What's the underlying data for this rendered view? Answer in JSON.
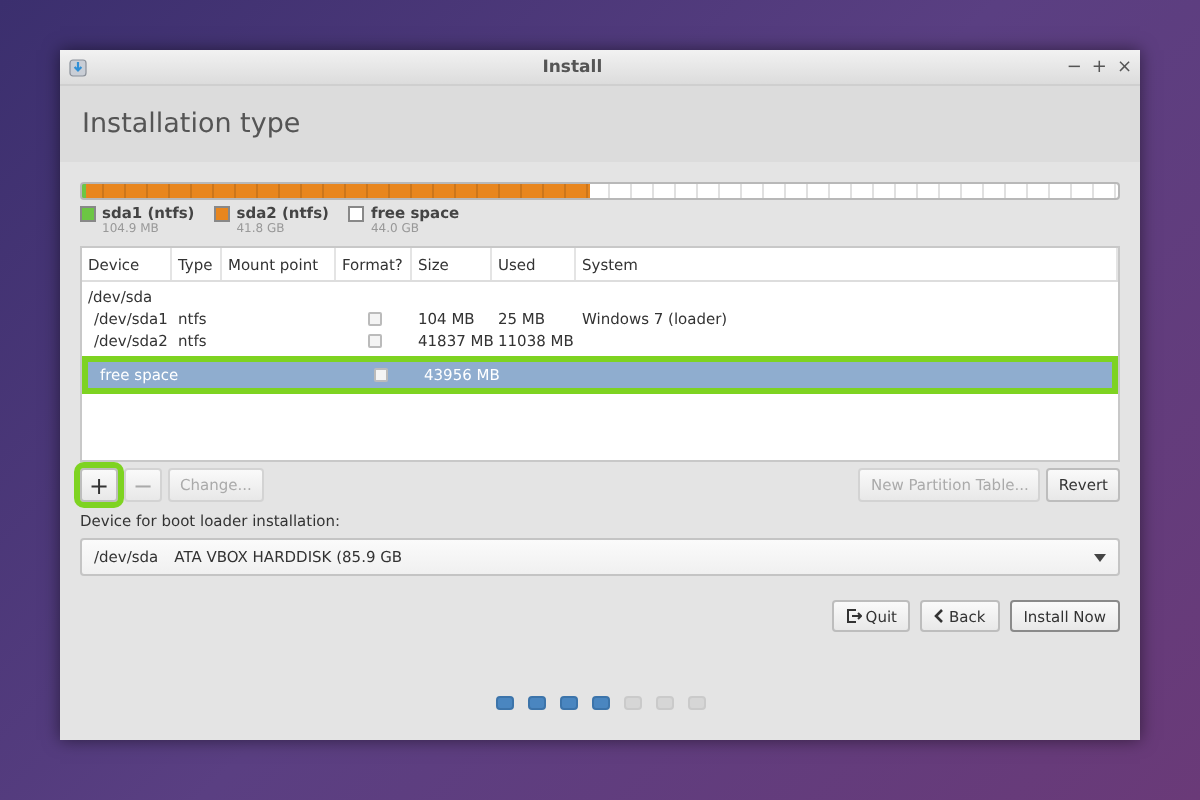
{
  "window": {
    "title": "Install",
    "controls": [
      "−",
      "+",
      "×"
    ]
  },
  "header": {
    "title": "Installation type"
  },
  "partition_bar": [
    {
      "name": "sda1 (ntfs)",
      "size": "104.9 MB",
      "color": "#6cc644",
      "level": 0.003
    },
    {
      "name": "sda2 (ntfs)",
      "size": "41.8 GB",
      "color": "#e8861e",
      "level": 0.487
    },
    {
      "name": "free space",
      "size": "44.0 GB",
      "color": "#ffffff",
      "level": 0.51
    }
  ],
  "table": {
    "columns": [
      "Device",
      "Type",
      "Mount point",
      "Format?",
      "Size",
      "Used",
      "System"
    ],
    "rows": [
      {
        "kind": "disk",
        "device": "/dev/sda",
        "selected": false,
        "highlighted": false
      },
      {
        "kind": "partition",
        "device": "/dev/sda1",
        "type": "ntfs",
        "format": false,
        "size": "104 MB",
        "used": "25 MB",
        "system": "Windows 7 (loader)",
        "selected": false,
        "highlighted": false
      },
      {
        "kind": "partition",
        "device": "/dev/sda2",
        "type": "ntfs",
        "format": false,
        "size": "41837 MB",
        "used": "11038 MB",
        "selected": false,
        "highlighted": false
      },
      {
        "kind": "free",
        "device": "free space",
        "format": false,
        "size": "43956 MB",
        "selected": true,
        "highlighted": true
      }
    ]
  },
  "table_buttons": [
    {
      "kind": "icon",
      "label": "+",
      "disabled": false,
      "highlighted": true
    },
    {
      "kind": "icon",
      "label": "−",
      "disabled": true,
      "highlighted": false
    },
    {
      "kind": "text",
      "label": "Change...",
      "disabled": true,
      "highlighted": false
    },
    {
      "kind": "spacer"
    },
    {
      "kind": "text",
      "label": "New Partition Table...",
      "disabled": true,
      "highlighted": false
    },
    {
      "kind": "text",
      "label": "Revert",
      "disabled": false,
      "highlighted": false
    }
  ],
  "boot_loader": {
    "label": "Device for boot loader installation:",
    "device": "/dev/sda",
    "description": "ATA VBOX HARDDISK (85.9 GB"
  },
  "actions": [
    {
      "kind": "quit",
      "label": "Quit",
      "default": false
    },
    {
      "kind": "back",
      "label": "Back",
      "default": false
    },
    {
      "kind": "plain",
      "label": "Install Now",
      "default": true
    }
  ],
  "steps": [
    {
      "done": true
    },
    {
      "done": true
    },
    {
      "done": true
    },
    {
      "done": true
    },
    {
      "done": false
    },
    {
      "done": false
    },
    {
      "done": false
    }
  ]
}
